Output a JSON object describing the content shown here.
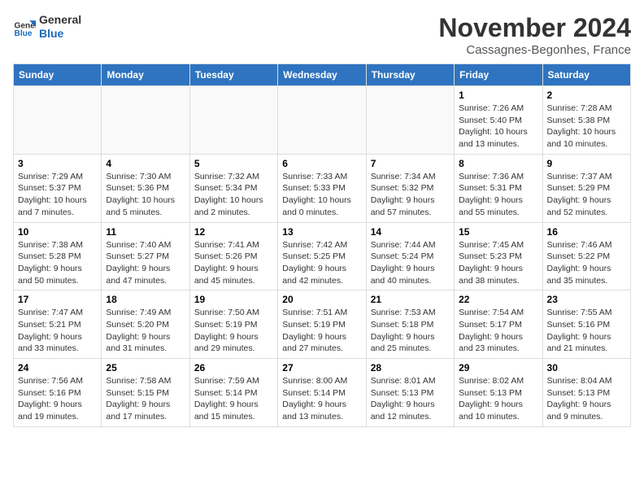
{
  "logo": {
    "text_general": "General",
    "text_blue": "Blue"
  },
  "header": {
    "month": "November 2024",
    "location": "Cassagnes-Begonhes, France"
  },
  "weekdays": [
    "Sunday",
    "Monday",
    "Tuesday",
    "Wednesday",
    "Thursday",
    "Friday",
    "Saturday"
  ],
  "weeks": [
    [
      {
        "day": "",
        "info": ""
      },
      {
        "day": "",
        "info": ""
      },
      {
        "day": "",
        "info": ""
      },
      {
        "day": "",
        "info": ""
      },
      {
        "day": "",
        "info": ""
      },
      {
        "day": "1",
        "info": "Sunrise: 7:26 AM\nSunset: 5:40 PM\nDaylight: 10 hours and 13 minutes."
      },
      {
        "day": "2",
        "info": "Sunrise: 7:28 AM\nSunset: 5:38 PM\nDaylight: 10 hours and 10 minutes."
      }
    ],
    [
      {
        "day": "3",
        "info": "Sunrise: 7:29 AM\nSunset: 5:37 PM\nDaylight: 10 hours and 7 minutes."
      },
      {
        "day": "4",
        "info": "Sunrise: 7:30 AM\nSunset: 5:36 PM\nDaylight: 10 hours and 5 minutes."
      },
      {
        "day": "5",
        "info": "Sunrise: 7:32 AM\nSunset: 5:34 PM\nDaylight: 10 hours and 2 minutes."
      },
      {
        "day": "6",
        "info": "Sunrise: 7:33 AM\nSunset: 5:33 PM\nDaylight: 10 hours and 0 minutes."
      },
      {
        "day": "7",
        "info": "Sunrise: 7:34 AM\nSunset: 5:32 PM\nDaylight: 9 hours and 57 minutes."
      },
      {
        "day": "8",
        "info": "Sunrise: 7:36 AM\nSunset: 5:31 PM\nDaylight: 9 hours and 55 minutes."
      },
      {
        "day": "9",
        "info": "Sunrise: 7:37 AM\nSunset: 5:29 PM\nDaylight: 9 hours and 52 minutes."
      }
    ],
    [
      {
        "day": "10",
        "info": "Sunrise: 7:38 AM\nSunset: 5:28 PM\nDaylight: 9 hours and 50 minutes."
      },
      {
        "day": "11",
        "info": "Sunrise: 7:40 AM\nSunset: 5:27 PM\nDaylight: 9 hours and 47 minutes."
      },
      {
        "day": "12",
        "info": "Sunrise: 7:41 AM\nSunset: 5:26 PM\nDaylight: 9 hours and 45 minutes."
      },
      {
        "day": "13",
        "info": "Sunrise: 7:42 AM\nSunset: 5:25 PM\nDaylight: 9 hours and 42 minutes."
      },
      {
        "day": "14",
        "info": "Sunrise: 7:44 AM\nSunset: 5:24 PM\nDaylight: 9 hours and 40 minutes."
      },
      {
        "day": "15",
        "info": "Sunrise: 7:45 AM\nSunset: 5:23 PM\nDaylight: 9 hours and 38 minutes."
      },
      {
        "day": "16",
        "info": "Sunrise: 7:46 AM\nSunset: 5:22 PM\nDaylight: 9 hours and 35 minutes."
      }
    ],
    [
      {
        "day": "17",
        "info": "Sunrise: 7:47 AM\nSunset: 5:21 PM\nDaylight: 9 hours and 33 minutes."
      },
      {
        "day": "18",
        "info": "Sunrise: 7:49 AM\nSunset: 5:20 PM\nDaylight: 9 hours and 31 minutes."
      },
      {
        "day": "19",
        "info": "Sunrise: 7:50 AM\nSunset: 5:19 PM\nDaylight: 9 hours and 29 minutes."
      },
      {
        "day": "20",
        "info": "Sunrise: 7:51 AM\nSunset: 5:19 PM\nDaylight: 9 hours and 27 minutes."
      },
      {
        "day": "21",
        "info": "Sunrise: 7:53 AM\nSunset: 5:18 PM\nDaylight: 9 hours and 25 minutes."
      },
      {
        "day": "22",
        "info": "Sunrise: 7:54 AM\nSunset: 5:17 PM\nDaylight: 9 hours and 23 minutes."
      },
      {
        "day": "23",
        "info": "Sunrise: 7:55 AM\nSunset: 5:16 PM\nDaylight: 9 hours and 21 minutes."
      }
    ],
    [
      {
        "day": "24",
        "info": "Sunrise: 7:56 AM\nSunset: 5:16 PM\nDaylight: 9 hours and 19 minutes."
      },
      {
        "day": "25",
        "info": "Sunrise: 7:58 AM\nSunset: 5:15 PM\nDaylight: 9 hours and 17 minutes."
      },
      {
        "day": "26",
        "info": "Sunrise: 7:59 AM\nSunset: 5:14 PM\nDaylight: 9 hours and 15 minutes."
      },
      {
        "day": "27",
        "info": "Sunrise: 8:00 AM\nSunset: 5:14 PM\nDaylight: 9 hours and 13 minutes."
      },
      {
        "day": "28",
        "info": "Sunrise: 8:01 AM\nSunset: 5:13 PM\nDaylight: 9 hours and 12 minutes."
      },
      {
        "day": "29",
        "info": "Sunrise: 8:02 AM\nSunset: 5:13 PM\nDaylight: 9 hours and 10 minutes."
      },
      {
        "day": "30",
        "info": "Sunrise: 8:04 AM\nSunset: 5:13 PM\nDaylight: 9 hours and 9 minutes."
      }
    ]
  ]
}
